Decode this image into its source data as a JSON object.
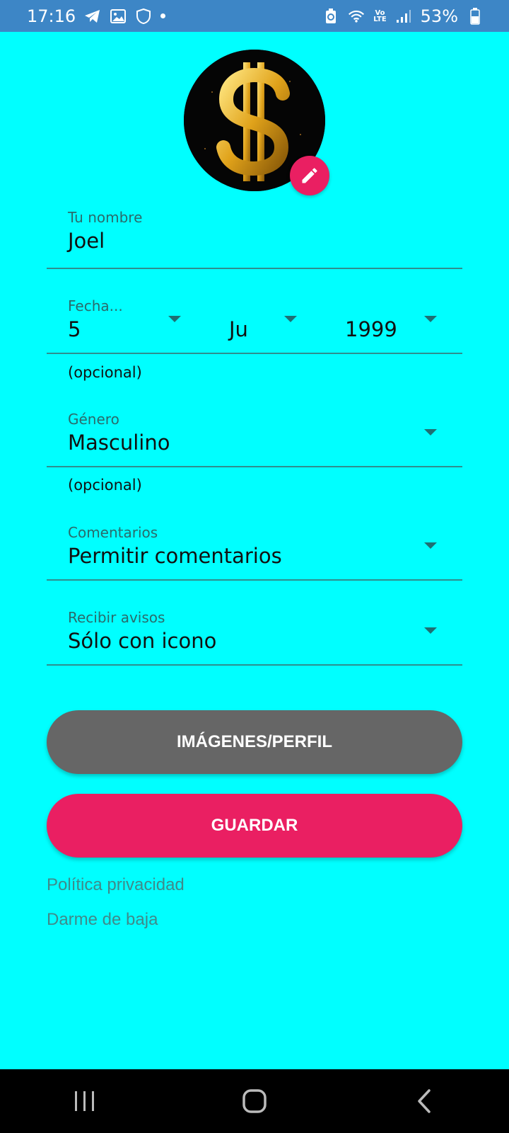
{
  "status_bar": {
    "time": "17:16",
    "battery_percent": "53%",
    "icons_left": [
      "telegram-icon",
      "image-icon",
      "shield-icon",
      "dot-icon"
    ],
    "icons_right": [
      "battery-saver-icon",
      "wifi-icon",
      "volte-icon",
      "signal-icon",
      "battery-icon"
    ],
    "volte_label_top": "Vo",
    "volte_label_bottom": "LTE"
  },
  "profile": {
    "avatar_icon": "gold-dollar-sign-image",
    "edit_icon": "pencil-icon"
  },
  "form": {
    "name": {
      "label": "Tu nombre",
      "value": "Joel"
    },
    "birthdate": {
      "label": "Fecha...",
      "day": "5",
      "month": "Ju",
      "year": "1999",
      "helper": "(opcional)"
    },
    "gender": {
      "label": "Género",
      "value": "Masculino",
      "helper": "(opcional)"
    },
    "comments": {
      "label": "Comentarios",
      "value": "Permitir comentarios"
    },
    "notifications": {
      "label": "Recibir avisos",
      "value": "Sólo con icono"
    }
  },
  "buttons": {
    "images_profile": "IMÁGENES/PERFIL",
    "save": "GUARDAR"
  },
  "links": {
    "privacy": "Política privacidad",
    "unsubscribe": "Darme de baja"
  },
  "colors": {
    "background": "#00ffff",
    "status_bar": "#3d86c6",
    "accent": "#ea1f62",
    "secondary_button": "#666666"
  },
  "nav": {
    "icons": [
      "recent-apps-icon",
      "home-icon",
      "back-icon"
    ]
  }
}
